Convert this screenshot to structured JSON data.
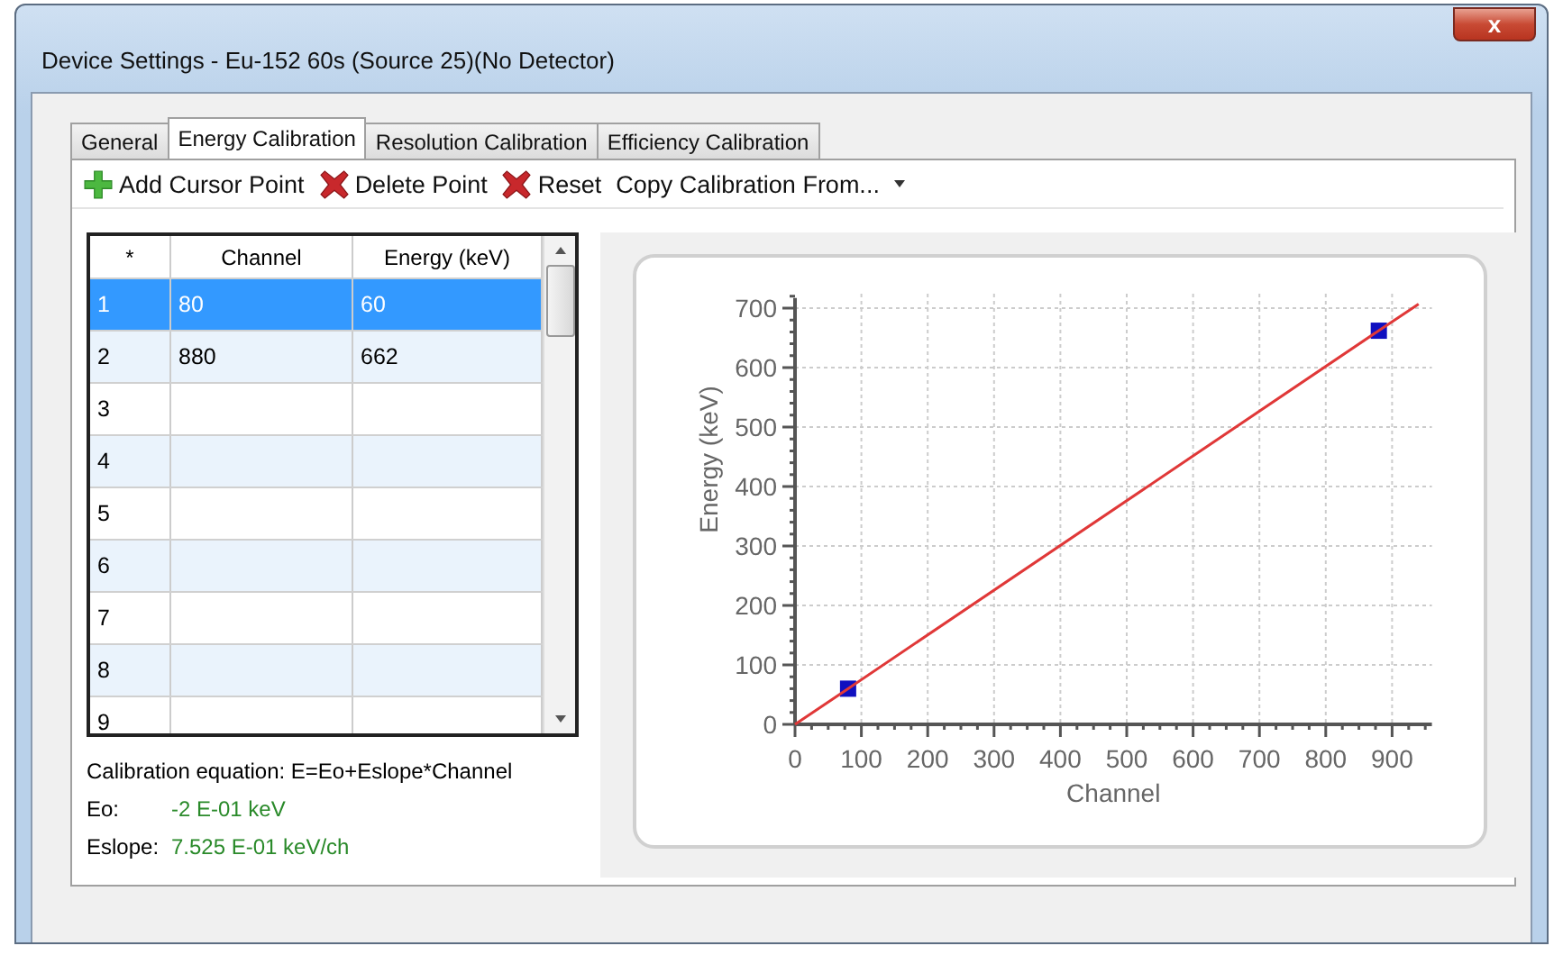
{
  "window": {
    "title": "Device Settings - Eu-152 60s (Source 25)(No Detector)",
    "close": "x"
  },
  "tabs": [
    {
      "label": "General",
      "selected": false
    },
    {
      "label": "Energy Calibration",
      "selected": true
    },
    {
      "label": "Resolution Calibration",
      "selected": false
    },
    {
      "label": "Efficiency Calibration",
      "selected": false
    }
  ],
  "toolbar": [
    {
      "label": "Add Cursor Point",
      "kind": "add"
    },
    {
      "label": "Delete Point",
      "kind": "delete"
    },
    {
      "label": "Reset",
      "kind": "delete"
    },
    {
      "label": "Copy Calibration From...",
      "kind": "dropdown"
    }
  ],
  "table": {
    "columns": [
      "*",
      "Channel",
      "Energy (keV)"
    ],
    "rows": [
      {
        "index": "1",
        "channel": "80",
        "energy": "60",
        "selected": true
      },
      {
        "index": "2",
        "channel": "880",
        "energy": "662",
        "selected": false
      },
      {
        "index": "3",
        "selected": false
      },
      {
        "index": "4",
        "selected": false
      },
      {
        "index": "5",
        "selected": false
      },
      {
        "index": "6",
        "selected": false
      },
      {
        "index": "7",
        "selected": false
      },
      {
        "index": "8",
        "selected": false
      },
      {
        "index": "9",
        "selected": false
      }
    ]
  },
  "equation": "Calibration equation: E=Eo+Eslope*Channel",
  "params": [
    {
      "label": "Eo:",
      "value": "-2 E-01 keV"
    },
    {
      "label": "Eslope:",
      "value": "7.525 E-01 keV/ch"
    }
  ],
  "chart": {
    "chart_data": {
      "type": "scatter",
      "xlabel": "Channel",
      "ylabel": "Energy (keV)",
      "x": [
        0,
        80,
        880,
        940
      ],
      "series": [
        {
          "type": "scatter",
          "color": "#1010c0",
          "values": [
            null,
            60,
            662,
            null
          ]
        },
        {
          "type": "line",
          "color": "#e03838",
          "values": [
            0,
            60,
            662,
            707
          ]
        }
      ],
      "xlim": [
        0,
        960
      ],
      "ylim": [
        0,
        720
      ],
      "grid": true,
      "xticks": [
        0,
        100,
        200,
        300,
        400,
        500,
        600,
        700,
        800,
        900
      ],
      "yticks": [
        0,
        100,
        200,
        300,
        400,
        500,
        600,
        700
      ]
    }
  }
}
